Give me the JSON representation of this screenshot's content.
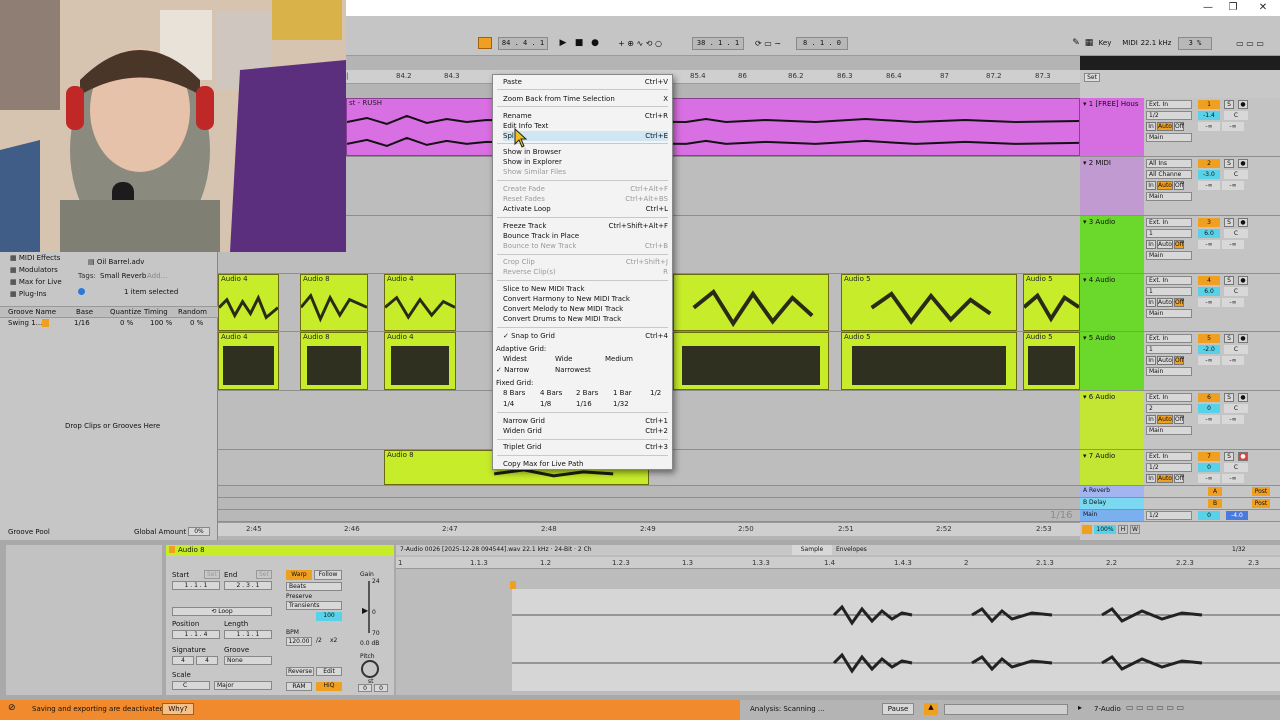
{
  "window": {
    "minimize": "—",
    "restore": "❐",
    "close": "✕"
  },
  "transport": {
    "position": "84 .  4 .  1",
    "loop_start": "38 .  1 .  1",
    "loop_length": "8 .  1 .  0",
    "key_label": "Key",
    "midi_label": "MIDI",
    "sample_rate": "22.1 kHz",
    "cpu": "3 %"
  },
  "ruler": {
    "ticks": [
      "84.2",
      "84.3",
      "85.4",
      "86",
      "86.2",
      "86.3",
      "86.4",
      "87",
      "87.2",
      "87.3"
    ],
    "set_label": "Set"
  },
  "time_ruler": {
    "ticks": [
      "2:45",
      "2:46",
      "2:47",
      "2:48",
      "2:49",
      "2:50",
      "2:51",
      "2:52",
      "2:53"
    ]
  },
  "arrangement": {
    "top_clip_label": "st - RUSH",
    "zoom_label": "1/16",
    "clips": {
      "a4": "Audio 4",
      "a8": "Audio 8",
      "a5": "Audio 5"
    }
  },
  "browser": {
    "items": [
      "MIDI Effects",
      "Modulators",
      "Max for Live",
      "Plug-Ins"
    ],
    "file": "Oil Barrel.adv",
    "tags_label": "Tags:",
    "tag": "Small Reverb",
    "add": "Add...",
    "selected": "1 item selected",
    "groove_headers": [
      "Groove Name",
      "Base",
      "Quantize",
      "Timing",
      "Random"
    ],
    "groove_row": {
      "name": "Swing 1...",
      "base": "1/16",
      "quantize": "0 %",
      "timing": "100 %",
      "random": "0 %"
    },
    "drop_hint": "Drop Clips or Grooves Here",
    "groove_pool": "Groove Pool",
    "global_amount_label": "Global Amount",
    "global_amount": "0%"
  },
  "tracks": [
    {
      "name": "1 [FREE] Hous",
      "input": "Ext. In",
      "channel": "1/2",
      "num": "1",
      "vol": "-1.4",
      "pan": "C",
      "out": "Main",
      "color": "#c86ad2"
    },
    {
      "name": "2 MIDI",
      "input": "All Ins",
      "channel": "All Channe",
      "num": "2",
      "vol": "-3.0",
      "pan": "C",
      "out": "Main",
      "color": "#c09ad0"
    },
    {
      "name": "3 Audio",
      "input": "Ext. In",
      "channel": "1",
      "num": "3",
      "vol": "6.0",
      "pan": "C",
      "out": "Main",
      "color": "#6bd92b"
    },
    {
      "name": "4 Audio",
      "input": "Ext. In",
      "channel": "1",
      "num": "4",
      "vol": "6.0",
      "pan": "C",
      "out": "Main",
      "color": "#6bd92b"
    },
    {
      "name": "5 Audio",
      "input": "Ext. In",
      "channel": "1",
      "num": "5",
      "vol": "-2.0",
      "pan": "C",
      "out": "Main",
      "color": "#6bd92b"
    },
    {
      "name": "6 Audio",
      "input": "Ext. In",
      "channel": "2",
      "num": "6",
      "vol": "0",
      "pan": "C",
      "out": "Main",
      "color": "#c3e533"
    },
    {
      "name": "7 Audio",
      "input": "Ext. In",
      "channel": "1/2",
      "num": "7",
      "vol": "0",
      "pan": "C",
      "out": "Main",
      "color": "#c3e533"
    }
  ],
  "track_labels": {
    "in": "In",
    "auto": "Auto",
    "off": "Off",
    "inf": "-∞",
    "s": "S"
  },
  "returns": [
    {
      "name": "A Reverb",
      "letter": "A",
      "post": "Post"
    },
    {
      "name": "B Delay",
      "letter": "B",
      "post": "Post"
    }
  ],
  "main": {
    "name": "Main",
    "channel": "1/2",
    "vol": "0",
    "pan": "-4.0"
  },
  "mixer_footer": {
    "zoom": "100%",
    "h": "H",
    "w": "W"
  },
  "context_menu": {
    "items": [
      {
        "label": "Paste",
        "shortcut": "Ctrl+V",
        "disabled": false
      },
      {
        "label": "Zoom Back from Time Selection",
        "shortcut": "X",
        "disabled": false
      },
      {
        "label": "Rename",
        "shortcut": "Ctrl+R",
        "disabled": false
      },
      {
        "label": "Edit Info Text",
        "shortcut": "",
        "disabled": false
      },
      {
        "label": "Split",
        "shortcut": "Ctrl+E",
        "disabled": false
      },
      {
        "label": "Show in Browser",
        "shortcut": "",
        "disabled": false
      },
      {
        "label": "Show in Explorer",
        "shortcut": "",
        "disabled": false
      },
      {
        "label": "Show Similar Files",
        "shortcut": "",
        "disabled": true
      },
      {
        "label": "Create Fade",
        "shortcut": "Ctrl+Alt+F",
        "disabled": true
      },
      {
        "label": "Reset Fades",
        "shortcut": "Ctrl+Alt+BS",
        "disabled": true
      },
      {
        "label": "Activate Loop",
        "shortcut": "Ctrl+L",
        "disabled": false
      },
      {
        "label": "Freeze Track",
        "shortcut": "Ctrl+Shift+Alt+F",
        "disabled": false
      },
      {
        "label": "Bounce Track in Place",
        "shortcut": "",
        "disabled": false
      },
      {
        "label": "Bounce to New Track",
        "shortcut": "Ctrl+B",
        "disabled": true
      },
      {
        "label": "Crop Clip",
        "shortcut": "Ctrl+Shift+J",
        "disabled": true
      },
      {
        "label": "Reverse Clip(s)",
        "shortcut": "R",
        "disabled": true
      },
      {
        "label": "Slice to New MIDI Track",
        "shortcut": "",
        "disabled": false
      },
      {
        "label": "Convert Harmony to New MIDI Track",
        "shortcut": "",
        "disabled": false
      },
      {
        "label": "Convert Melody to New MIDI Track",
        "shortcut": "",
        "disabled": false
      },
      {
        "label": "Convert Drums to New MIDI Track",
        "shortcut": "",
        "disabled": false
      },
      {
        "label": "Snap to Grid",
        "shortcut": "Ctrl+4",
        "disabled": false
      },
      {
        "label": "Narrow Grid",
        "shortcut": "Ctrl+1",
        "disabled": false
      },
      {
        "label": "Widen Grid",
        "shortcut": "Ctrl+2",
        "disabled": false
      },
      {
        "label": "Triplet Grid",
        "shortcut": "Ctrl+3",
        "disabled": false
      },
      {
        "label": "Copy Max for Live Path",
        "shortcut": "",
        "disabled": false
      }
    ],
    "adaptive_label": "Adaptive Grid:",
    "adaptive": [
      "Widest",
      "Wide",
      "Medium",
      "Narrow",
      "Narrowest"
    ],
    "fixed_label": "Fixed Grid:",
    "fixed": [
      "8 Bars",
      "4 Bars",
      "2 Bars",
      "1 Bar",
      "1/2",
      "1/4",
      "1/8",
      "1/16",
      "1/32"
    ],
    "check": "✓"
  },
  "clip_detail": {
    "clip_name": "Audio 8",
    "start_label": "Start",
    "end_label": "End",
    "set": "Set",
    "start": "1 .  1 .  1",
    "end": "2 .  3 .  1",
    "warp": "Warp",
    "follow": "Follow",
    "mode": "Beats",
    "preserve_label": "Preserve",
    "preserve": "Transients",
    "grain": "100",
    "loop": "Loop",
    "position_label": "Position",
    "length_label": "Length",
    "position": "1 .  1 .  4",
    "length": "1 .  1 .  1",
    "bpm_label": "BPM",
    "bpm": "120.00",
    "half": "/2",
    "double": "x2",
    "signature_label": "Signature",
    "sig_num": "4",
    "sig_den": "4",
    "groove_label": "Groove",
    "groove": "None",
    "scale_label": "Scale",
    "scale_root": "C",
    "scale_mode": "Major",
    "gain_label": "Gain",
    "gain_top": "24",
    "gain_mid": "0",
    "gain_bot": "70",
    "gain_db": "0.0 dB",
    "pitch_label": "Pitch",
    "pitch_unit": "st",
    "pitch": "0",
    "detune": "0",
    "reverse": "Reverse",
    "edit": "Edit",
    "ram": "RAM",
    "hiq": "HiQ"
  },
  "sample_view": {
    "file_info": "7-Audio 0026 [2025-12-28 094544].wav  22.1 kHz · 24-Bit · 2 Ch",
    "tab_sample": "Sample",
    "tab_envelopes": "Envelopes",
    "grid": "1/32",
    "ticks": [
      "1",
      "1.1.3",
      "1.2",
      "1.2.3",
      "1.3",
      "1.3.3",
      "1.4",
      "1.4.3",
      "2",
      "2.1.3",
      "2.2",
      "2.2.3",
      "2.3"
    ]
  },
  "status": {
    "warning": "Saving and exporting are deactivated.",
    "why": "Why?",
    "analysis": "Analysis: Scanning ...",
    "pause": "Pause",
    "track": "7-Audio"
  },
  "colors": {
    "accent_orange": "#f08a2c",
    "lime": "#c6ec2a",
    "magenta": "#d66de0",
    "green": "#6bd92b"
  }
}
